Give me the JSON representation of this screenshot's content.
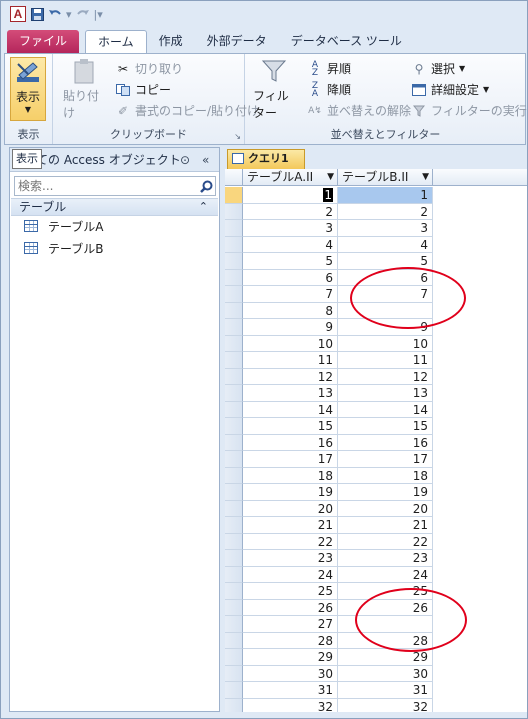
{
  "qat": {
    "app_icon": "A",
    "redo_glyph": "▾",
    "customize_glyph": "|▾"
  },
  "tabs": [
    "ファイル",
    "ホーム",
    "作成",
    "外部データ",
    "データベース ツール"
  ],
  "ribbon": {
    "view_label": "表示",
    "view_group_label": "表示",
    "paste_label": "貼り付け",
    "cut_label": "切り取り",
    "copy_label": "コピー",
    "format_painter_label": "書式のコピー/貼り付け",
    "clipboard_group_label": "クリップボード",
    "filter_label": "フィルター",
    "ascending_label": "昇順",
    "descending_label": "降順",
    "remove_sort_label": "並べ替えの解除",
    "selection_label": "選択",
    "advanced_label": "詳細設定",
    "toggle_filter_label": "フィルターの実行",
    "sort_group_label": "並べ替えとフィルター"
  },
  "nav": {
    "tooltip": "表示",
    "header_title": "ての Access オブジェクト",
    "search_placeholder": "検索...",
    "group_label": "テーブル",
    "items": [
      "テーブルA",
      "テーブルB"
    ]
  },
  "datasheet": {
    "tab_label": "クエリ1",
    "col_a_header": "テーブルA.II",
    "col_b_header": "テーブルB.II",
    "rows": [
      {
        "a": "1",
        "b": "1"
      },
      {
        "a": "2",
        "b": "2"
      },
      {
        "a": "3",
        "b": "3"
      },
      {
        "a": "4",
        "b": "4"
      },
      {
        "a": "5",
        "b": "5"
      },
      {
        "a": "6",
        "b": "6"
      },
      {
        "a": "7",
        "b": "7"
      },
      {
        "a": "8",
        "b": ""
      },
      {
        "a": "9",
        "b": "9"
      },
      {
        "a": "10",
        "b": "10"
      },
      {
        "a": "11",
        "b": "11"
      },
      {
        "a": "12",
        "b": "12"
      },
      {
        "a": "13",
        "b": "13"
      },
      {
        "a": "14",
        "b": "14"
      },
      {
        "a": "15",
        "b": "15"
      },
      {
        "a": "16",
        "b": "16"
      },
      {
        "a": "17",
        "b": "17"
      },
      {
        "a": "18",
        "b": "18"
      },
      {
        "a": "19",
        "b": "19"
      },
      {
        "a": "20",
        "b": "20"
      },
      {
        "a": "21",
        "b": "21"
      },
      {
        "a": "22",
        "b": "22"
      },
      {
        "a": "23",
        "b": "23"
      },
      {
        "a": "24",
        "b": "24"
      },
      {
        "a": "25",
        "b": "25"
      },
      {
        "a": "26",
        "b": "26"
      },
      {
        "a": "27",
        "b": ""
      },
      {
        "a": "28",
        "b": "28"
      },
      {
        "a": "29",
        "b": "29"
      },
      {
        "a": "30",
        "b": "30"
      },
      {
        "a": "31",
        "b": "31"
      },
      {
        "a": "32",
        "b": "32"
      }
    ]
  },
  "colors": {
    "file_tab": "#b3245a",
    "active_row": "#f9d67e",
    "highlight_cell": "#a8c8ee",
    "annotation_ring": "#e0001b"
  }
}
